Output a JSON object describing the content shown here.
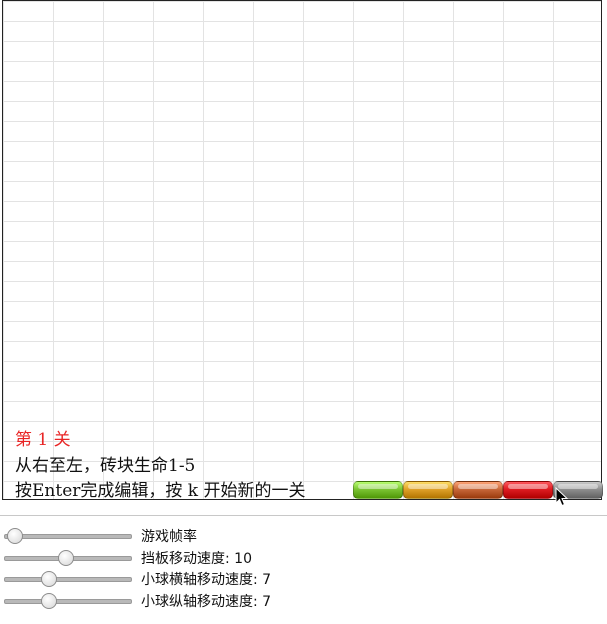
{
  "canvas": {
    "level_text": "第 1 关",
    "rule_text": "从右至左，砖块生命1-5",
    "hint_text": "按Enter完成编辑，按 k 开始新的一关",
    "level_color": "#e82525"
  },
  "palette": [
    {
      "name": "green-brick",
      "color": "#7cc534"
    },
    {
      "name": "orange-brick",
      "color": "#e0a22a"
    },
    {
      "name": "copper-brick",
      "color": "#c8683a"
    },
    {
      "name": "red-brick",
      "color": "#df1c22"
    },
    {
      "name": "gray-brick",
      "color": "#8f8f8f"
    }
  ],
  "controls": [
    {
      "name": "fps-slider",
      "label": "游戏帧率",
      "value": 0.03
    },
    {
      "name": "paddle-speed-slider",
      "label": "挡板移动速度: 10",
      "value": 0.48
    },
    {
      "name": "ball-x-speed-slider",
      "label": "小球横轴移动速度: 7",
      "value": 0.33
    },
    {
      "name": "ball-y-speed-slider",
      "label": "小球纵轴移动速度: 7",
      "value": 0.33
    }
  ]
}
